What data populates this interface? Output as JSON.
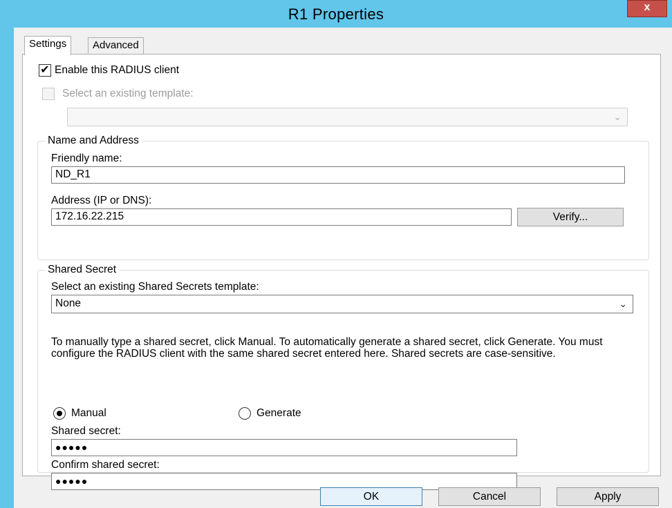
{
  "window": {
    "title": "R1 Properties",
    "close_glyph": "x",
    "titlebar_color": "#61c6ea",
    "close_color": "#c7504b"
  },
  "tabs": [
    {
      "label": "Settings",
      "selected": true
    },
    {
      "label": "Advanced",
      "selected": false
    }
  ],
  "settings": {
    "enable_client": {
      "label": "Enable this RADIUS client",
      "checked": true,
      "check_glyph": "✔"
    },
    "existing_template": {
      "label": "Select an existing template:",
      "checked": false,
      "enabled": false,
      "combo_value": ""
    },
    "name_address": {
      "group_title": "Name and Address",
      "friendly_name_label": "Friendly name:",
      "friendly_name_value": "ND_R1",
      "address_label": "Address (IP or DNS):",
      "address_value": "172.16.22.215",
      "verify_button": "Verify..."
    },
    "shared_secret": {
      "group_title": "Shared Secret",
      "template_label": "Select an existing Shared Secrets template:",
      "template_value": "None",
      "description": "To manually type a shared secret, click Manual. To automatically generate a shared secret, click Generate. You must configure the RADIUS client with the same shared secret entered here. Shared secrets are case-sensitive.",
      "manual_label": "Manual",
      "generate_label": "Generate",
      "selected_mode": "Manual",
      "secret_label": "Shared secret:",
      "secret_value": "●●●●●",
      "confirm_label": "Confirm shared secret:",
      "confirm_value": "●●●●●"
    }
  },
  "buttons": {
    "ok": "OK",
    "cancel": "Cancel",
    "apply": "Apply"
  },
  "icons": {
    "dropdown": "chevron-down-icon",
    "check": "check-icon",
    "close": "close-icon"
  }
}
